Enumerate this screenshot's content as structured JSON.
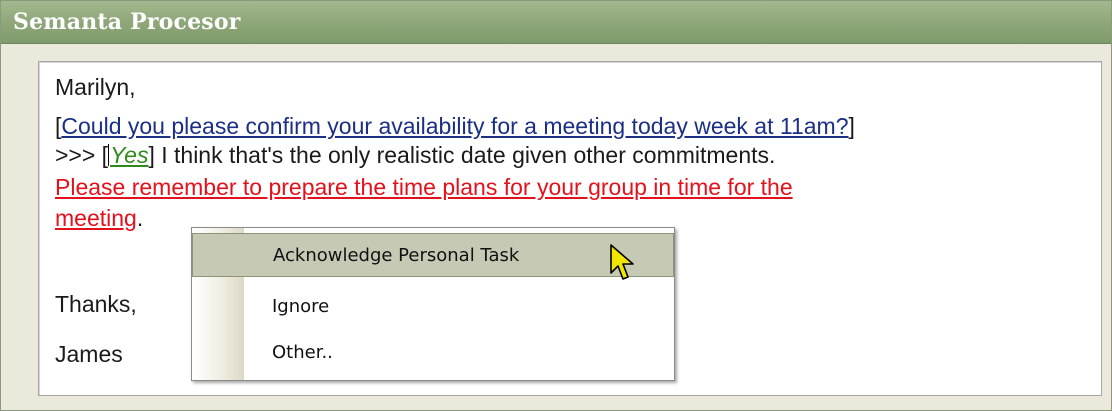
{
  "window": {
    "title": "Semanta Procesor"
  },
  "email": {
    "greeting": "Marilyn,",
    "request_open": "[",
    "request_text": "Could you please confirm your availability for a meeting today week at 11am?",
    "request_close": "]",
    "reply_prefix": ">>> [",
    "reply_tag": "Yes",
    "reply_rest": "] I think that's the only realistic date given other commitments.",
    "task_line1": "Please remember to prepare the time plans for your group in time for the",
    "task_line2": "meeting",
    "task_end": ".",
    "signoff": "Thanks,",
    "signature": "James"
  },
  "context_menu": {
    "items": [
      {
        "label": "Acknowledge Personal Task",
        "highlighted": true
      },
      {
        "label": "Ignore",
        "highlighted": false
      },
      {
        "label": "Other..",
        "highlighted": false
      }
    ]
  },
  "colors": {
    "title_bar": "#8fa77a",
    "request_link": "#1b2f86",
    "yes_tag": "#2f8a1c",
    "task_link": "#e3111b",
    "menu_highlight": "#c6cab5",
    "pointer_fill": "#f2e600"
  },
  "icons": {
    "pointer": "mouse-pointer-icon"
  }
}
